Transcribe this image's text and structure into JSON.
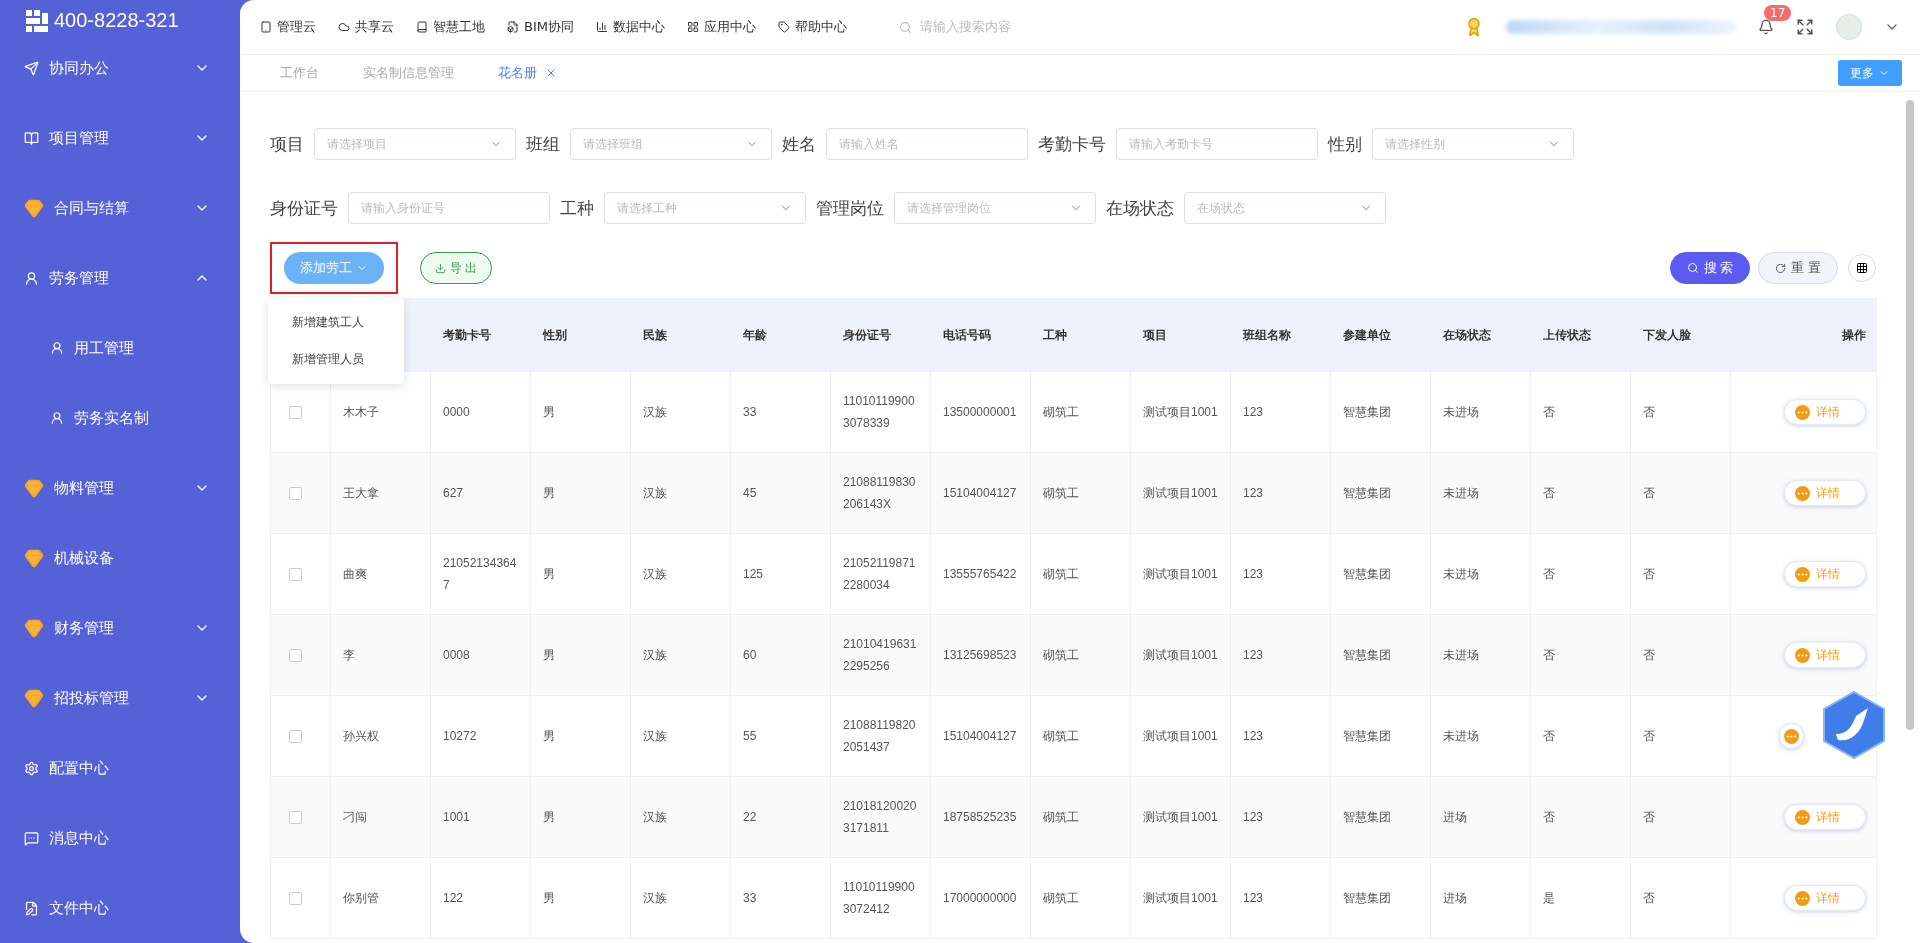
{
  "sidebar": {
    "phone": "400-8228-321",
    "items": [
      {
        "label": "协同办公",
        "expanded": false
      },
      {
        "label": "项目管理",
        "expanded": false
      },
      {
        "label": "合同与结算",
        "expanded": false
      },
      {
        "label": "劳务管理",
        "expanded": true,
        "children": [
          {
            "label": "用工管理"
          },
          {
            "label": "劳务实名制"
          }
        ]
      },
      {
        "label": "物料管理",
        "expanded": false
      },
      {
        "label": "机械设备"
      },
      {
        "label": "财务管理",
        "expanded": false
      },
      {
        "label": "招投标管理",
        "expanded": false
      },
      {
        "label": "配置中心"
      },
      {
        "label": "消息中心"
      },
      {
        "label": "文件中心"
      }
    ]
  },
  "top_nav": {
    "items": [
      "管理云",
      "共享云",
      "智慧工地",
      "BIM协同",
      "数据中心",
      "应用中心",
      "帮助中心"
    ],
    "search": {
      "placeholder": "请输入搜索内容"
    },
    "notifications": "17"
  },
  "tabs": [
    {
      "label": "工作台",
      "selected": false
    },
    {
      "label": "实名制信息管理",
      "selected": false
    },
    {
      "label": "花名册",
      "selected": true,
      "closable": true
    }
  ],
  "more_button": "更多",
  "filters": [
    {
      "label": "项目",
      "placeholder": "请选择项目",
      "kind": "select"
    },
    {
      "label": "班组",
      "placeholder": "请选择班组",
      "kind": "select"
    },
    {
      "label": "姓名",
      "placeholder": "请输入姓名",
      "kind": "input"
    },
    {
      "label": "考勤卡号",
      "placeholder": "请输入考勤卡号",
      "kind": "input"
    },
    {
      "label": "性别",
      "placeholder": "请选择性别",
      "kind": "select"
    },
    {
      "label": "身份证号",
      "placeholder": "请输入身份证号",
      "kind": "input"
    },
    {
      "label": "工种",
      "placeholder": "请选择工种",
      "kind": "select"
    },
    {
      "label": "管理岗位",
      "placeholder": "请选择管理岗位",
      "kind": "select"
    },
    {
      "label": "在场状态",
      "placeholder": "在场状态",
      "kind": "select"
    }
  ],
  "actions": {
    "add": {
      "label": "添加劳工",
      "highlighted": true,
      "menu": [
        "新增建筑工人",
        "新增管理人员"
      ]
    },
    "export": "导 出",
    "search": "搜 索",
    "reset": "重 置"
  },
  "table": {
    "columns": [
      "",
      "考勤卡号",
      "性别",
      "民族",
      "年龄",
      "身份证号",
      "电话号码",
      "工种",
      "项目",
      "班组名称",
      "参建单位",
      "在场状态",
      "上传状态",
      "下发人脸",
      "操作"
    ],
    "rows": [
      {
        "checked": false,
        "cells": [
          "木木子",
          "0000",
          "男",
          "汉族",
          "33",
          "110101199003078339",
          "13500000001",
          "砌筑工",
          "测试项目1001",
          "123",
          "智慧集团",
          "未进场",
          "否",
          "否"
        ],
        "action": "详情"
      },
      {
        "checked": false,
        "cells": [
          "王大拿",
          "627",
          "男",
          "汉族",
          "45",
          "21088119830206143X",
          "15104004127",
          "砌筑工",
          "测试项目1001",
          "123",
          "智慧集团",
          "未进场",
          "否",
          "否"
        ],
        "action": "详情"
      },
      {
        "checked": false,
        "cells": [
          "曲爽",
          "210521343647",
          "男",
          "汉族",
          "125",
          "210521198712280034",
          "13555765422",
          "砌筑工",
          "测试项目1001",
          "123",
          "智慧集团",
          "未进场",
          "否",
          "否"
        ],
        "action": "详情"
      },
      {
        "checked": false,
        "cells": [
          "李",
          "0008",
          "男",
          "汉族",
          "60",
          "210104196312295256",
          "13125698523",
          "砌筑工",
          "测试项目1001",
          "123",
          "智慧集团",
          "未进场",
          "否",
          "否"
        ],
        "action": "详情"
      },
      {
        "checked": false,
        "cells": [
          "孙兴权",
          "10272",
          "男",
          "汉族",
          "55",
          "210881198202051437",
          "15104004127",
          "砌筑工",
          "测试项目1001",
          "123",
          "智慧集团",
          "未进场",
          "否",
          "否"
        ]
      },
      {
        "checked": false,
        "cells": [
          "刁闯",
          "1001",
          "男",
          "汉族",
          "22",
          "210181200203171811",
          "18758525235",
          "砌筑工",
          "测试项目1001",
          "123",
          "智慧集团",
          "进场",
          "否",
          "否"
        ],
        "action": "详情"
      },
      {
        "checked": false,
        "cells": [
          "你别管",
          "122",
          "男",
          "汉族",
          "33",
          "110101199003072412",
          "17000000000",
          "砌筑工",
          "测试项目1001",
          "123",
          "智慧集团",
          "进场",
          "是",
          "否"
        ],
        "action": "详情"
      }
    ]
  }
}
